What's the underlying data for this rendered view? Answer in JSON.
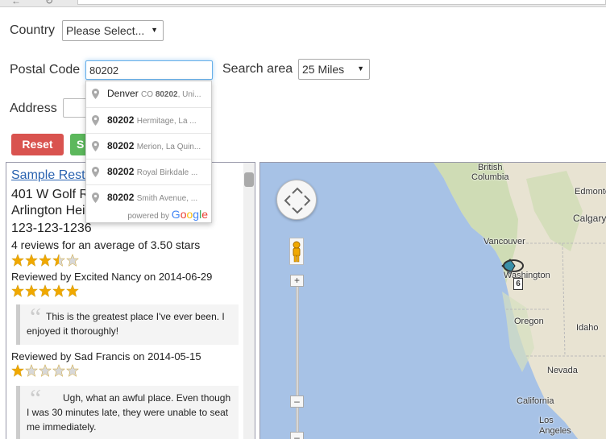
{
  "form": {
    "country_label": "Country",
    "country_value": "Please Select...",
    "postal_label": "Postal Code",
    "postal_value": "80202",
    "search_area_label": "Search area",
    "search_area_value": "25 Miles",
    "address_label": "Address",
    "reset_label": "Reset",
    "search_label": "S"
  },
  "autocomplete": {
    "items": [
      {
        "main": "Denver",
        "sec_prefix": "CO ",
        "sec_bold": "80202",
        "sec_rest": ", Uni..."
      },
      {
        "main": "80202",
        "sec_prefix": "Hermitage, La ...",
        "sec_bold": "",
        "sec_rest": ""
      },
      {
        "main": "80202",
        "sec_prefix": "Merion, La Quin...",
        "sec_bold": "",
        "sec_rest": ""
      },
      {
        "main": "80202",
        "sec_prefix": "Royal Birkdale ...",
        "sec_bold": "",
        "sec_rest": ""
      },
      {
        "main": "80202",
        "sec_prefix": "Smith Avenue, ...",
        "sec_bold": "",
        "sec_rest": ""
      }
    ],
    "powered_by": "powered by",
    "brand": "Google",
    "brand_colors": [
      "#4285f4",
      "#ea4335",
      "#fbbc05",
      "#4285f4",
      "#34a853",
      "#ea4335"
    ]
  },
  "restaurant": {
    "name": "Sample Resta",
    "address_line1": "401 W Golf R",
    "address_line2": "Arlington Hei",
    "phone": "123-123-1236",
    "summary": "4 reviews for an average of 3.50 stars",
    "rating": 3.5
  },
  "reviews": [
    {
      "by": "Reviewed by Excited Nancy on 2014-06-29",
      "rating": 5,
      "text": "This is the greatest place I've ever been. I enjoyed it thoroughly!"
    },
    {
      "by": "Reviewed by Sad Francis on 2014-05-15",
      "rating": 1,
      "text": "Ugh, what an awful place. Even though I was 30 minutes late, they were unable to seat me immediately."
    }
  ],
  "map": {
    "labels": {
      "british_columbia": "British\nColumbia",
      "edmonton": "Edmonton",
      "calgary": "Calgary",
      "vancouver": "Vancouver",
      "washington": "Washington",
      "oregon": "Oregon",
      "idaho": "Idaho",
      "nevada": "Nevada",
      "california": "California",
      "los_angeles": "Los\nAngeles"
    },
    "cluster_count": "6",
    "colors": {
      "ocean": "#a7c2e6",
      "land": "#e8e3d2",
      "forest": "#cfdcb5"
    }
  },
  "colors": {
    "reset": "#d9534f",
    "search": "#5cb85c",
    "link": "#2a63b0",
    "star": "#f0a800",
    "star_empty": "#d8d8d8"
  }
}
